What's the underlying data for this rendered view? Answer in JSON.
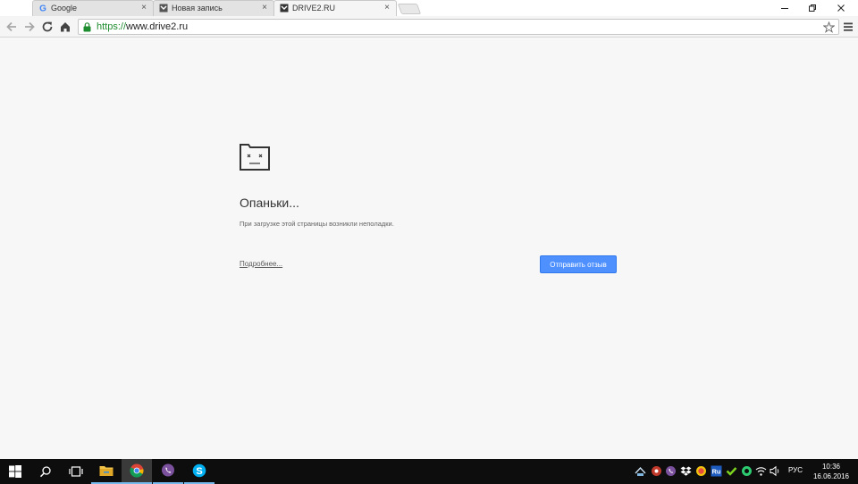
{
  "browser": {
    "tabs": [
      {
        "title": "Google",
        "icon": "google-icon"
      },
      {
        "title": "Новая запись",
        "icon": "drive2-icon"
      },
      {
        "title": "DRIVE2.RU",
        "icon": "drive2-icon",
        "active": true
      }
    ],
    "address_bar": {
      "scheme": "https://",
      "host": "www.drive2.ru"
    }
  },
  "error_page": {
    "title": "Опаньки...",
    "description": "При загрузке этой страницы возникли неполадки.",
    "details_link": "Подробнее...",
    "feedback_button": "Отправить отзыв",
    "icon": "sad-folder-icon"
  },
  "taskbar": {
    "language": "РУС",
    "time": "10:36",
    "date": "16.06.2016",
    "apps": [
      "start-icon",
      "search-icon",
      "task-view-icon",
      "file-explorer-icon",
      "chrome-icon",
      "viber-icon",
      "skype-icon"
    ],
    "tray_items": [
      "network-icon",
      "tray-app-icon",
      "viber-icon",
      "dropbox-icon",
      "tray-app-icon",
      "ru-icon",
      "tray-app-icon",
      "tray-app-icon",
      "wifi-icon",
      "volume-icon",
      "keyboard-icon"
    ],
    "tray_ru_label": "Ru"
  },
  "colors": {
    "accent": "#4d90fe",
    "secure_green": "#1d8c2e",
    "taskbar": "#0d0d0d"
  }
}
